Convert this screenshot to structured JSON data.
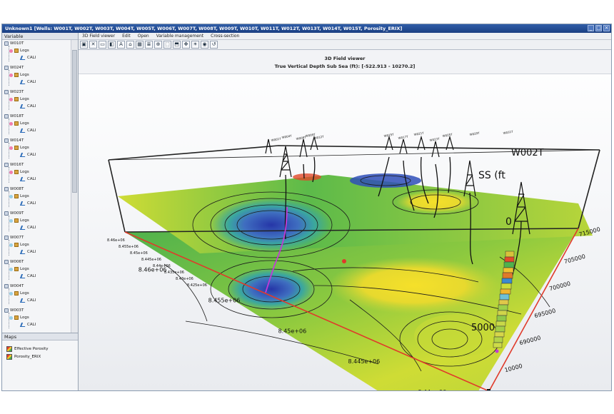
{
  "window": {
    "title": "Unknown1 [Wells: W001T, W002T, W003T, W004T, W005T, W006T, W007T, W008T, W009T, W010T, W011T, W012T, W013T, W014T, W015T, Porosity_ERIX]",
    "colors": {
      "titlebar": "#2f5da8",
      "panel": "#f4f5f7"
    }
  },
  "variable_pane": {
    "header": "Variable",
    "wells": [
      {
        "name": "W010T",
        "color": "#f07fb0"
      },
      {
        "name": "W024T",
        "color": "#f07fb0"
      },
      {
        "name": "W023T",
        "color": "#f07fb0"
      },
      {
        "name": "W018T",
        "color": "#f07fb0"
      },
      {
        "name": "W014T",
        "color": "#f07fb0"
      },
      {
        "name": "W016T",
        "color": "#f07fb0"
      },
      {
        "name": "W008T",
        "color": "#9ad0e8"
      },
      {
        "name": "W009T",
        "color": "#9ad0e8"
      },
      {
        "name": "W007T",
        "color": "#9ad0e8"
      },
      {
        "name": "W006T",
        "color": "#9ad0e8"
      },
      {
        "name": "W004T",
        "color": "#9ad0e8"
      },
      {
        "name": "W003T",
        "color": "#9ad0e8"
      }
    ],
    "log_label": "Logs",
    "curve_label": "CALI"
  },
  "maps_pane": {
    "header": "Maps",
    "items": [
      "Effective Porosity",
      "Porosity_ERIX"
    ]
  },
  "menu": [
    "3D Field viewer",
    "Edit",
    "Open",
    "Variable management",
    "Cross-section"
  ],
  "toolbar": {
    "icons": [
      "save-icon",
      "close-icon",
      "layout-icon",
      "camera-icon",
      "text-icon",
      "home-icon",
      "grid-icon",
      "list-icon",
      "zoom-icon",
      "pointer-icon",
      "select-icon",
      "pan-icon",
      "sun-icon",
      "palette-icon",
      "reset-icon"
    ],
    "glyphs": [
      "▣",
      "✕",
      "▭",
      "◧",
      "A",
      "⌂",
      "▦",
      "≣",
      "⊕",
      "⬚",
      "⬒",
      "✥",
      "☀",
      "◉",
      "↺"
    ]
  },
  "viewer": {
    "title": "3D Field viewer",
    "subtitle": "True Vertical Depth Sub Sea (ft): [-522.913 - 10270.2]",
    "overlay_labels": {
      "well": "W002T",
      "axis": "SS (ft",
      "depth0": "0",
      "depth5000": "5000"
    },
    "x_ticks": [
      "8.46e+06",
      "8.455e+06",
      "8.45e+06",
      "8.445e+06",
      "8.44e+06"
    ],
    "y_ticks": [
      "715000",
      "705000",
      "700000",
      "695000",
      "690000",
      "10000"
    ],
    "left_ticks": [
      "8.46e+06",
      "8.455e+06",
      "8.45e+06",
      "8.445e+06",
      "8.44e+06",
      "8.435e+06",
      "8.43e+06",
      "8.425e+06"
    ],
    "well_labels": [
      "W001T",
      "W004T",
      "W008T",
      "W009T",
      "W012T",
      "W015T",
      "W017T",
      "W021T",
      "W023T",
      "W025T",
      "W029T",
      "W031T"
    ],
    "colors": {
      "low": "#2a3fb0",
      "mid": "#39b24a",
      "high": "#f5df2b",
      "red": "#e03a2a",
      "axis_red": "#e03a2a"
    }
  }
}
